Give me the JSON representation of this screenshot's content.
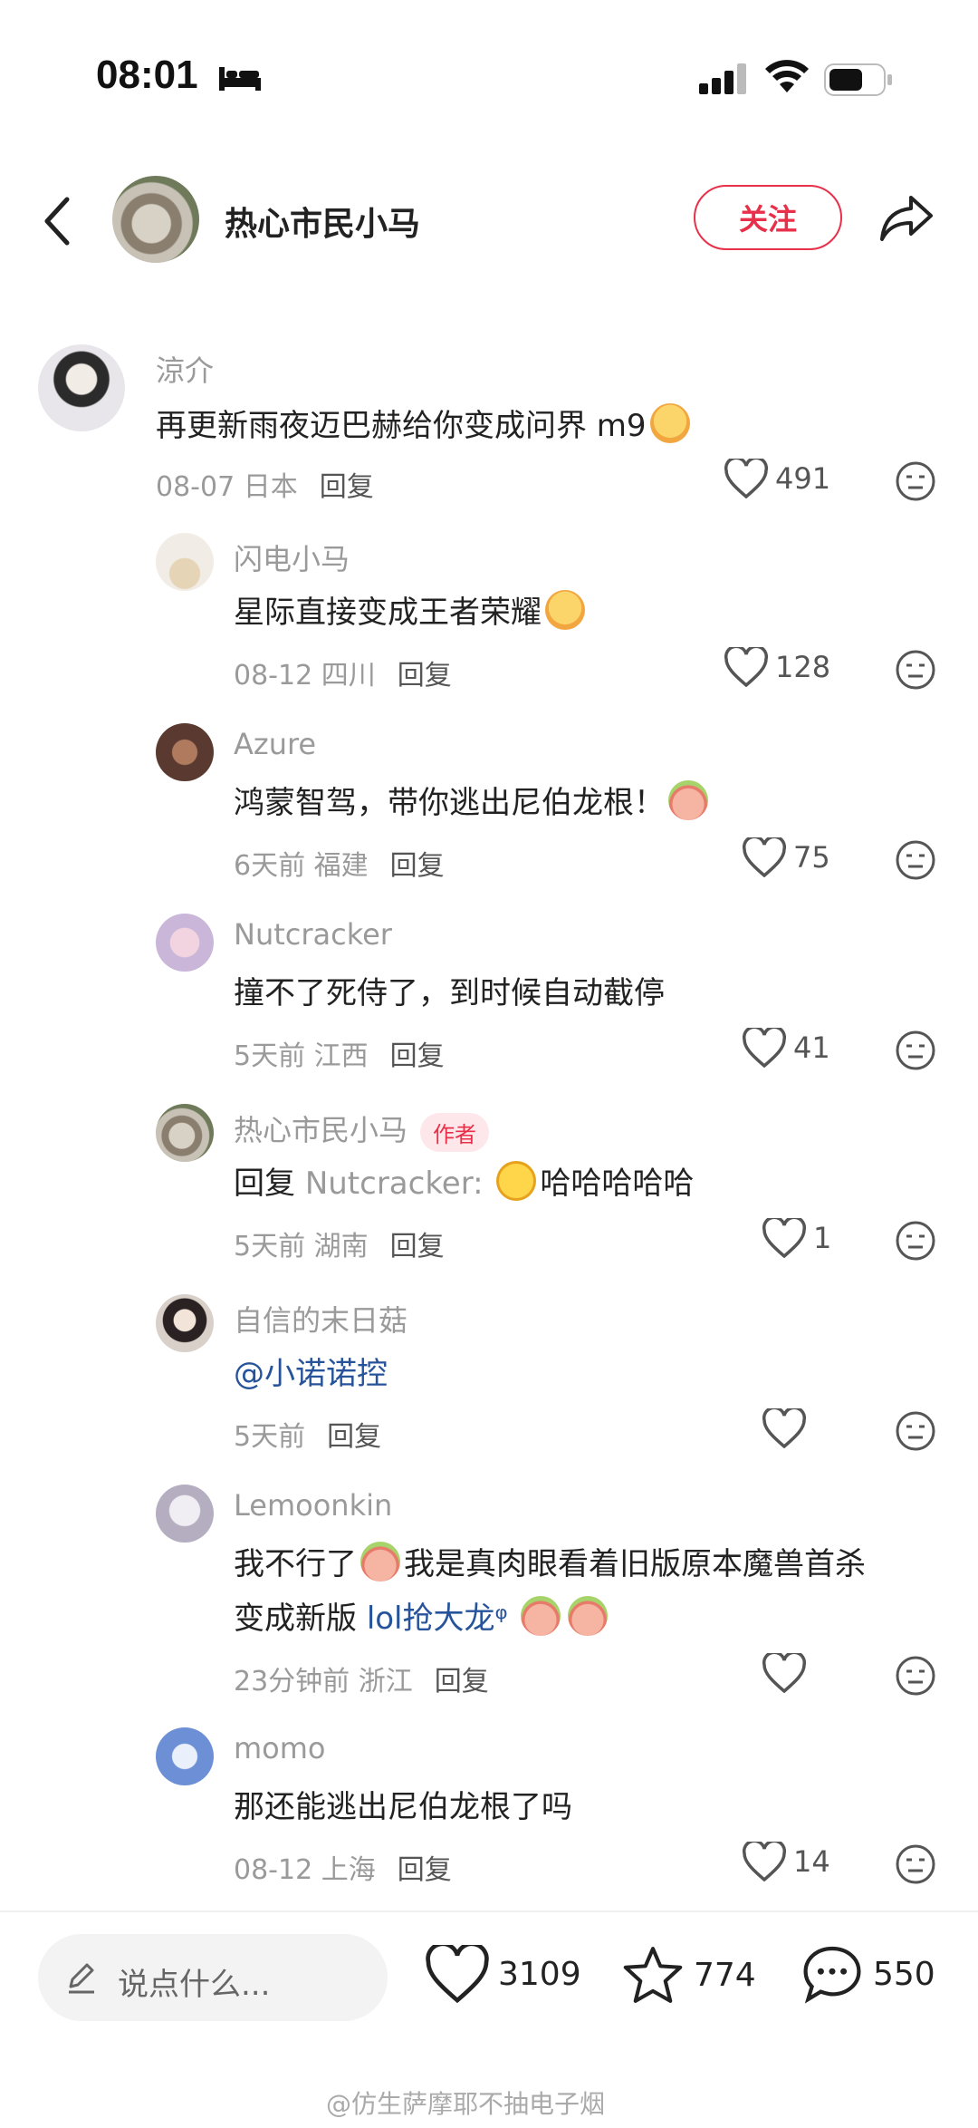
{
  "status": {
    "time": "08:01"
  },
  "header": {
    "name": "热心市民小马",
    "follow_label": "关注"
  },
  "comments": [
    {
      "user": "涼介",
      "text": "再更新雨夜迈巴赫给你变成问界 m9",
      "emojis": 1,
      "meta": "08-07 日本",
      "reply": "回复",
      "likes": "491"
    },
    {
      "user": "闪电小马",
      "text": "星际直接变成王者荣耀",
      "emojis": 1,
      "meta": "08-12 四川",
      "reply": "回复",
      "likes": "128"
    },
    {
      "user": "Azure",
      "text": "鸿蒙智驾，带你逃出尼伯龙根！",
      "emojis": 1,
      "meta": "6天前 福建",
      "reply": "回复",
      "likes": "75"
    },
    {
      "user": "Nutcracker",
      "text": "撞不了死侍了，到时候自动截停",
      "meta": "5天前 江西",
      "reply": "回复",
      "likes": "41"
    },
    {
      "user": "热心市民小马",
      "author_tag": "作者",
      "text_prefix": "回复 ",
      "text_mention": "Nutcracker:",
      "text": "哈哈哈哈哈",
      "meta": "5天前 湖南",
      "reply": "回复",
      "likes": "1"
    },
    {
      "user": "自信的末日菇",
      "mention": "@小诺诺控",
      "meta": "5天前",
      "reply": "回复",
      "likes": ""
    },
    {
      "user": "Lemoonkin",
      "text_line1_a": "我不行了",
      "text_line1_b": "我是真肉眼看着旧版原本魔兽首杀",
      "text_line2_a": "变成新版 ",
      "text_line2_link": "lol抢大龙",
      "text_line2_sup": "ᵠ",
      "meta": "23分钟前 浙江",
      "reply": "回复",
      "likes": ""
    },
    {
      "user": "momo",
      "text": "那还能逃出尼伯龙根了吗",
      "meta": "08-12 上海",
      "reply": "回复",
      "likes": "14"
    }
  ],
  "bottom": {
    "placeholder": "说点什么...",
    "likes": "3109",
    "stars": "774",
    "comments": "550"
  },
  "watermark": "@仿生萨摩耶不抽电子烟"
}
